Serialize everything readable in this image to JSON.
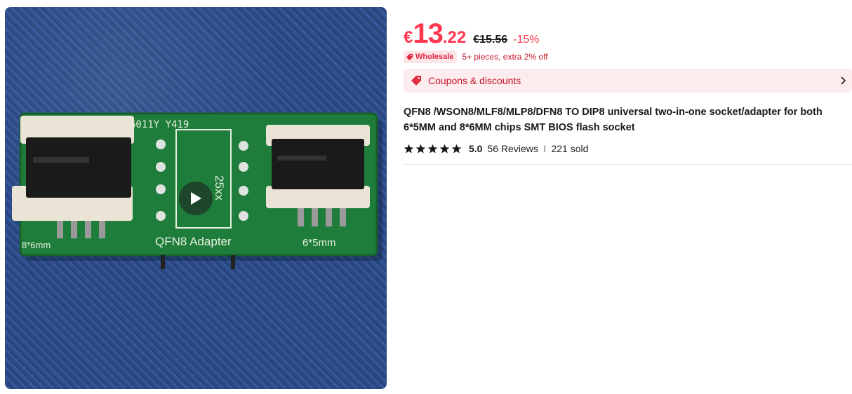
{
  "product": {
    "currency_symbol": "€",
    "price_int": "13",
    "price_dec": ".22",
    "original_price": "€15.56",
    "discount": "-15%",
    "wholesale_badge": "Wholesale",
    "wholesale_text": "5+ pieces, extra 2% off",
    "coupons_label": "Coupons & discounts",
    "title": "QFN8 /WSON8/MLF8/MLP8/DFN8 TO DIP8 universal two-in-one socket/adapter for both 6*5MM and 8*6MM chips SMT BIOS flash socket",
    "rating": "5.0",
    "star_count": 5,
    "reviews": "56 Reviews",
    "separator": "|",
    "sold": "221 sold"
  },
  "image": {
    "pcb_marking": "6011Y Y419",
    "chip_label": "25xx",
    "adapter_label": "QFN8 Adapter",
    "left_label": "8*6mm",
    "right_label": "6*5mm"
  },
  "colors": {
    "accent": "#fd384f",
    "star": "#191919",
    "pcb_green": "#1e7a3a"
  },
  "icons": {
    "play": "play-icon",
    "tag": "tag-icon",
    "chevron": "chevron-right-icon",
    "star": "star-icon"
  }
}
